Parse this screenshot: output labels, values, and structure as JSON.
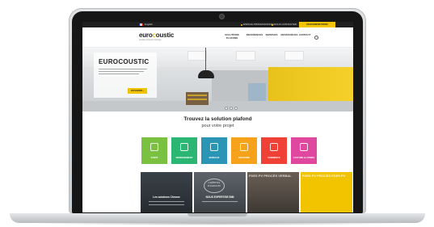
{
  "topbar": {
    "language": "English",
    "link1": "ESPACE PROFESSIONNEL",
    "link2": "NOUS CONTACTER",
    "cta": "DOCUMENTATION"
  },
  "brand": {
    "logo_pre": "euro",
    "logo_o": "c",
    "logo_post": "oustic",
    "tagline": "Quality Acoustic Ceilings"
  },
  "nav": {
    "items": [
      {
        "label": "SOLUTIONS PLAFOND"
      },
      {
        "label": "REFERENCES"
      },
      {
        "label": "SERVICES"
      },
      {
        "label": "RESSOURCES"
      },
      {
        "label": "CONTACT"
      }
    ]
  },
  "hero": {
    "title": "EUROCOUSTIC",
    "button": "EN SAVOIR +"
  },
  "finder": {
    "title": "Trouvez la solution plafond",
    "subtitle": "pour votre projet",
    "tiles": [
      {
        "label": "SANTÉ",
        "color": "#7ac142",
        "icon": "health-icon"
      },
      {
        "label": "ENSEIGNEMENT",
        "color": "#2bb673",
        "icon": "education-icon"
      },
      {
        "label": "BUREAUX",
        "color": "#2b95b5",
        "icon": "office-icon"
      },
      {
        "label": "INDUSTRIE",
        "color": "#f7a21b",
        "icon": "industry-icon"
      },
      {
        "label": "COMMERCE",
        "color": "#ef4136",
        "icon": "cart-icon"
      },
      {
        "label": "CULTURE & LOISIRS",
        "color": "#e0479e",
        "icon": "culture-icon"
      }
    ]
  },
  "cards": {
    "c1_title": "Les solutions Chrome",
    "c2_stamp": "L'HÔPITAL D'AJACCIO",
    "c2_title": "NOUS EXPERTISE BIM",
    "c3_words": "FDES PV PROCÈS VERBAL",
    "c4_words": "FDES PV PROCÈS FDES PV"
  }
}
